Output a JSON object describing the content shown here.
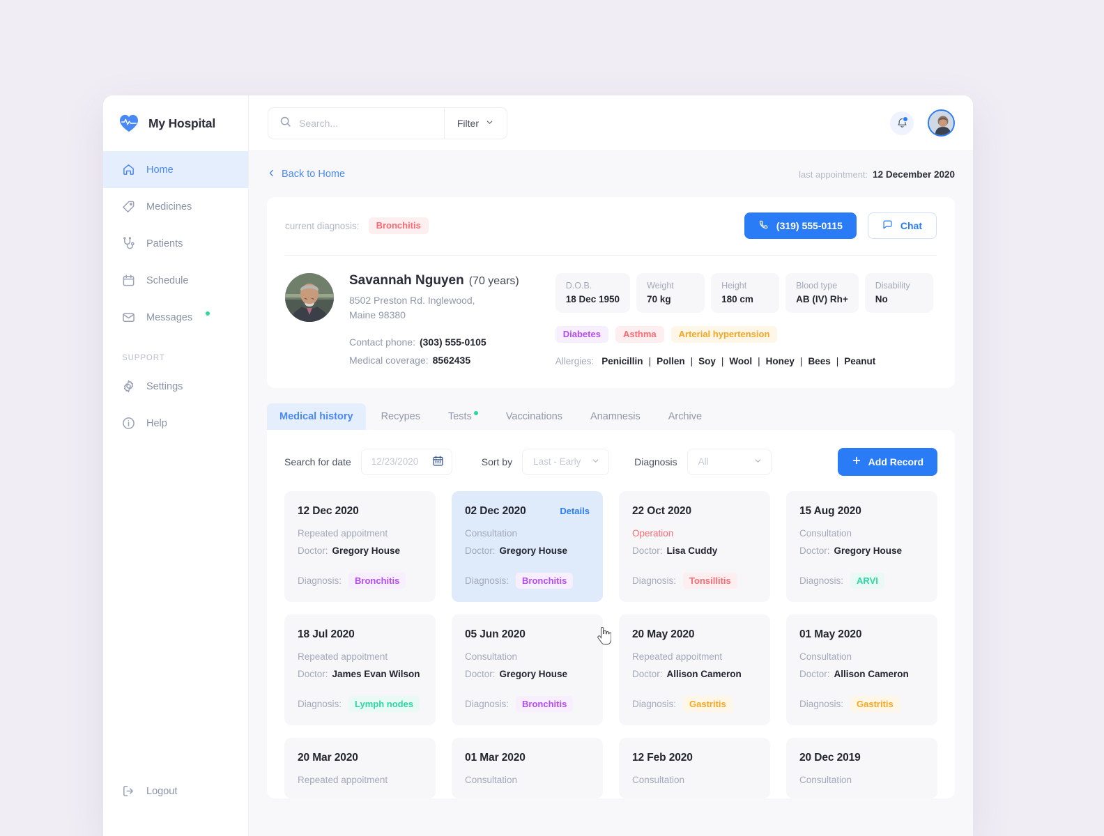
{
  "brand": {
    "name": "My Hospital",
    "logo_icon": "heart-pulse-icon"
  },
  "sidebar": {
    "items": [
      {
        "label": "Home",
        "icon": "home-icon",
        "active": true,
        "badge": false
      },
      {
        "label": "Medicines",
        "icon": "pill-tag-icon",
        "active": false,
        "badge": false
      },
      {
        "label": "Patients",
        "icon": "stethoscope-icon",
        "active": false,
        "badge": false
      },
      {
        "label": "Schedule",
        "icon": "calendar-icon",
        "active": false,
        "badge": false
      },
      {
        "label": "Messages",
        "icon": "mail-icon",
        "active": false,
        "badge": true
      }
    ],
    "support_label": "SUPPORT",
    "support_items": [
      {
        "label": "Settings",
        "icon": "gear-icon"
      },
      {
        "label": "Help",
        "icon": "info-circle-icon"
      }
    ],
    "logout": {
      "label": "Logout",
      "icon": "logout-icon"
    }
  },
  "topbar": {
    "search": {
      "placeholder": "Search...",
      "value": "",
      "icon": "search-icon"
    },
    "filter": {
      "label": "Filter",
      "icon": "chevron-down-icon"
    },
    "notifications": {
      "icon": "bell-icon",
      "has_unread": true
    },
    "avatar": {
      "icon": "user-avatar"
    }
  },
  "breadcrumb": {
    "back_label": "Back to Home",
    "back_icon": "chevron-left-icon",
    "last_appointment_label": "last appointment:",
    "last_appointment_value": "12 December 2020"
  },
  "patient": {
    "current_diagnosis_label": "current diagnosis:",
    "current_diagnosis": "Bronchitis",
    "call_button": {
      "label": "(319) 555-0115",
      "icon": "phone-icon"
    },
    "chat_button": {
      "label": "Chat",
      "icon": "chat-bubble-icon"
    },
    "name": "Savannah Nguyen",
    "age": "(70 years)",
    "address_line1": "8502 Preston Rd. Inglewood,",
    "address_line2": "Maine 98380",
    "contact_phone_label": "Contact phone:",
    "contact_phone": "(303) 555-0105",
    "coverage_label": "Medical coverage:",
    "coverage": "8562435",
    "vitals": [
      {
        "key": "D.O.B.",
        "value": "18 Dec 1950"
      },
      {
        "key": "Weight",
        "value": "70 kg"
      },
      {
        "key": "Height",
        "value": "180 cm"
      },
      {
        "key": "Blood type",
        "value": "AB (IV) Rh+"
      },
      {
        "key": "Disability",
        "value": "No"
      }
    ],
    "conditions": [
      {
        "label": "Diabetes",
        "color": "purple"
      },
      {
        "label": "Asthma",
        "color": "red"
      },
      {
        "label": "Arterial hypertension",
        "color": "orange"
      }
    ],
    "allergies_label": "Allergies:",
    "allergies": [
      "Penicillin",
      "Pollen",
      "Soy",
      "Wool",
      "Honey",
      "Bees",
      "Peanut"
    ]
  },
  "tabs": [
    {
      "label": "Medical history",
      "active": true,
      "badge": false
    },
    {
      "label": "Recypes",
      "active": false,
      "badge": false
    },
    {
      "label": "Tests",
      "active": false,
      "badge": true
    },
    {
      "label": "Vaccinations",
      "active": false,
      "badge": false
    },
    {
      "label": "Anamnesis",
      "active": false,
      "badge": false
    },
    {
      "label": "Archive",
      "active": false,
      "badge": false
    }
  ],
  "toolbar": {
    "date_label": "Search for date",
    "date_placeholder": "12/23/2020",
    "date_icon": "calendar-icon",
    "sort_label": "Sort by",
    "sort_value": "Last - Early",
    "diagnosis_label": "Diagnosis",
    "diagnosis_value": "All",
    "add_record_label": "Add Record",
    "add_icon": "plus-icon"
  },
  "record_labels": {
    "doctor": "Doctor:",
    "diagnosis": "Diagnosis:",
    "details": "Details"
  },
  "records": [
    {
      "date": "12 Dec 2020",
      "type": "Repeated appoitment",
      "type_style": "normal",
      "doctor": "Gregory House",
      "diagnosis": "Bronchitis",
      "diagnosis_color": "purple",
      "selected": false,
      "show_details": false
    },
    {
      "date": "02 Dec 2020",
      "type": "Consultation",
      "type_style": "normal",
      "doctor": "Gregory House",
      "diagnosis": "Bronchitis",
      "diagnosis_color": "purple",
      "selected": true,
      "show_details": true
    },
    {
      "date": "22 Oct 2020",
      "type": "Operation",
      "type_style": "operation",
      "doctor": "Lisa Cuddy",
      "diagnosis": "Tonsillitis",
      "diagnosis_color": "red",
      "selected": false,
      "show_details": false
    },
    {
      "date": "15 Aug 2020",
      "type": "Consultation",
      "type_style": "normal",
      "doctor": "Gregory House",
      "diagnosis": "ARVI",
      "diagnosis_color": "green",
      "selected": false,
      "show_details": false
    },
    {
      "date": "18 Jul 2020",
      "type": "Repeated appoitment",
      "type_style": "normal",
      "doctor": "James Evan Wilson",
      "diagnosis": "Lymph nodes",
      "diagnosis_color": "green",
      "selected": false,
      "show_details": false
    },
    {
      "date": "05 Jun 2020",
      "type": "Consultation",
      "type_style": "normal",
      "doctor": "Gregory House",
      "diagnosis": "Bronchitis",
      "diagnosis_color": "purple",
      "selected": false,
      "show_details": false
    },
    {
      "date": "20 May 2020",
      "type": "Repeated appoitment",
      "type_style": "normal",
      "doctor": "Allison Cameron",
      "diagnosis": "Gastritis",
      "diagnosis_color": "orange",
      "selected": false,
      "show_details": false
    },
    {
      "date": "01 May 2020",
      "type": "Consultation",
      "type_style": "normal",
      "doctor": "Allison Cameron",
      "diagnosis": "Gastritis",
      "diagnosis_color": "orange",
      "selected": false,
      "show_details": false
    },
    {
      "date": "20 Mar 2020",
      "type": "Repeated appoitment",
      "type_style": "normal",
      "doctor": "",
      "diagnosis": "",
      "diagnosis_color": "",
      "selected": false,
      "show_details": false
    },
    {
      "date": "01 Mar 2020",
      "type": "Consultation",
      "type_style": "normal",
      "doctor": "",
      "diagnosis": "",
      "diagnosis_color": "",
      "selected": false,
      "show_details": false
    },
    {
      "date": "12 Feb 2020",
      "type": "Consultation",
      "type_style": "normal",
      "doctor": "",
      "diagnosis": "",
      "diagnosis_color": "",
      "selected": false,
      "show_details": false
    },
    {
      "date": "20 Dec 2019",
      "type": "Consultation",
      "type_style": "normal",
      "doctor": "",
      "diagnosis": "",
      "diagnosis_color": "",
      "selected": false,
      "show_details": false
    }
  ],
  "colors": {
    "accent": "#2a7cf6",
    "accent_soft": "#e5eefc",
    "page_bg": "#f0edf5",
    "panel_bg": "#f8f8fb",
    "tag_red": "#f96b72",
    "tag_purple": "#b44bf5",
    "tag_orange": "#f5a623",
    "tag_green": "#2ed6a0",
    "text_dark": "#23252f",
    "text_muted": "#9097a9"
  }
}
